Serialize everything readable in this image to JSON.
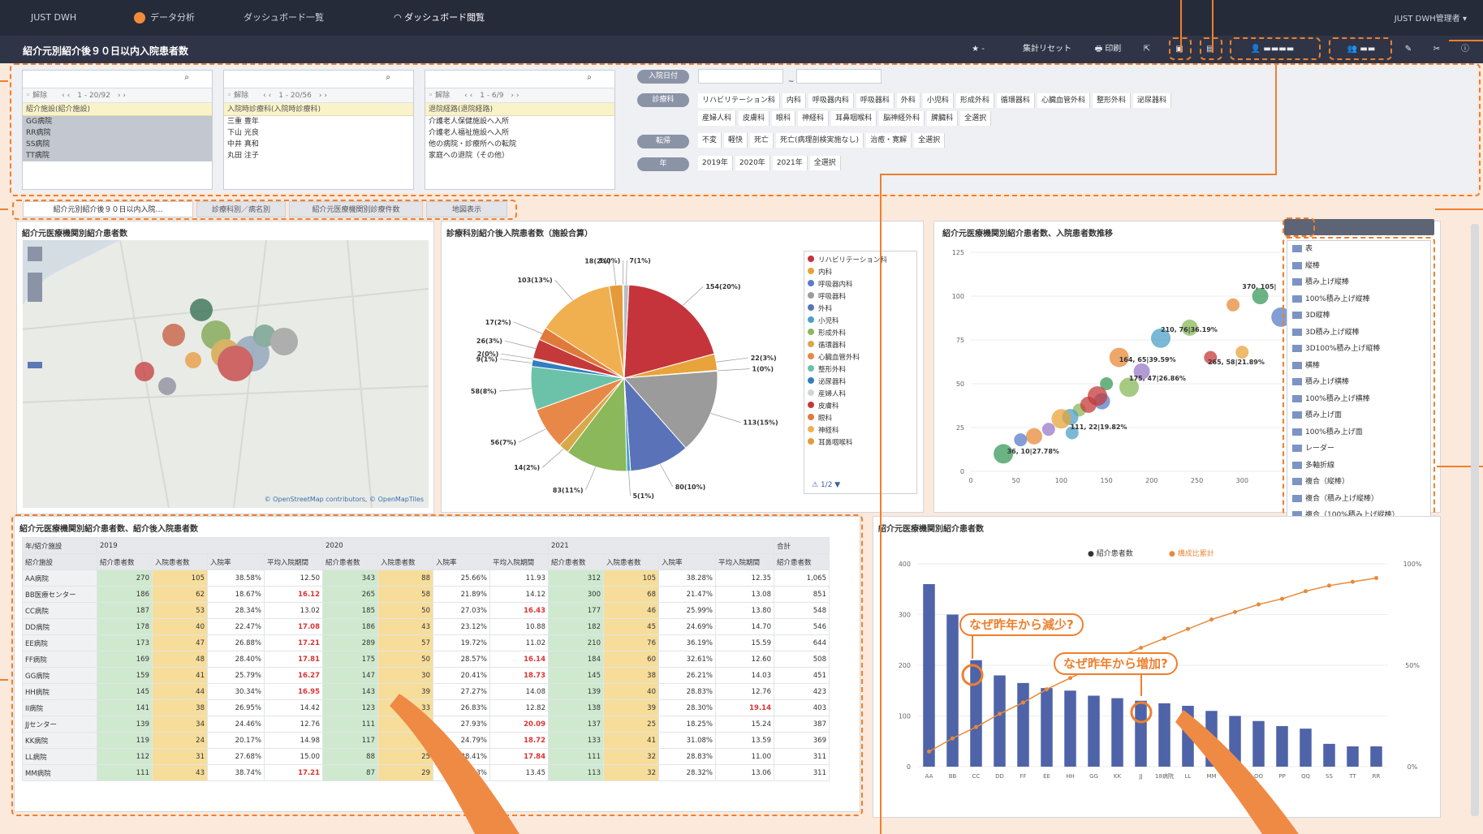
{
  "breadcrumbs": [
    "JUST DWH",
    "データ分析",
    "ダッシュボード一覧",
    "ダッシュボード閲覧"
  ],
  "user": "JUST DWH管理者 ▾",
  "title": "紹介元別紹介後９０日以内入院患者数",
  "toolbar": {
    "star": "★ -",
    "reset": "集計リセット",
    "print": "印刷"
  },
  "filters": {
    "lists": [
      {
        "paging": "1 - 20/92",
        "header": "紹介施設(紹介施設)",
        "rows": [
          "GG病院",
          "RR病院",
          "SS病院",
          "TT病院"
        ]
      },
      {
        "paging": "1 - 20/56",
        "header": "入院時診療科(入院時診療科)",
        "rows": [
          "三重 豊年",
          "下山 光良",
          "中井 真和",
          "丸田 注子"
        ]
      },
      {
        "paging": "1 - 6/9",
        "header": "退院経路(退院経路)",
        "rows": [
          "介護老人保健施設へ入所",
          "介護老人福祉施設へ入所",
          "他の病院・診療所への転院",
          "家庭への退院（その他）"
        ]
      }
    ],
    "groups": [
      {
        "label": "入院日付",
        "values": []
      },
      {
        "label": "診療科",
        "values": [
          "リハビリテーション科",
          "内科",
          "呼吸器内科",
          "呼吸器科",
          "外科",
          "小児科",
          "形成外科",
          "循環器科",
          "心臓血管外科",
          "整形外科",
          "泌尿器科",
          "産婦人科",
          "皮膚科",
          "眼科",
          "神経科",
          "耳鼻咽喉科",
          "脳神経外科",
          "脾臓科",
          "全選択"
        ]
      },
      {
        "label": "転帰",
        "values": [
          "不変",
          "軽快",
          "死亡",
          "死亡(病理剖検実施なし)",
          "治癒・寛解",
          "全選択"
        ]
      },
      {
        "label": "年",
        "values": [
          "2019年",
          "2020年",
          "2021年",
          "全選択"
        ]
      }
    ]
  },
  "tabs": [
    "紹介元別紹介後９０日以内入院…",
    "診療科別／病名別",
    "紹介元医療機関別診療件数",
    "地図表示"
  ],
  "panels": {
    "map": {
      "title": "紹介元医療機関別紹介患者数",
      "attribution": "© OpenStreetMap contributors, © OpenMapTiles"
    },
    "pie": {
      "title": "診療科別紹介後入院患者数（施設合算）",
      "legend_page": "1/2"
    },
    "scatter": {
      "title": "紹介元医療機関別紹介患者数、入院患者数推移"
    },
    "table": {
      "title": "紹介元医療機関別紹介患者数、紹介後入院患者数"
    },
    "combo": {
      "title": "紹介元医療機関別紹介患者数"
    }
  },
  "chart_types": [
    "表",
    "縦棒",
    "積み上げ縦棒",
    "100%積み上げ縦棒",
    "3D縦棒",
    "3D積み上げ縦棒",
    "3D100%積み上げ縦棒",
    "横棒",
    "積み上げ横棒",
    "100%積み上げ横棒",
    "積み上げ面",
    "100%積み上げ面",
    "レーダー",
    "多軸折線",
    "複合（縦棒）",
    "複合（積み上げ縦棒）",
    "複合（100%積み上げ縦棒）",
    "複合（マーカー）",
    "複合（縦棒・積み上げ縦棒）",
    "複合（横棒・積み上げ横棒）",
    "散布図",
    "バブル",
    "サマリー表示"
  ],
  "callouts": [
    "なぜ昨年から減少?",
    "なぜ昨年から増加?"
  ],
  "table": {
    "years": [
      "2019",
      "2020",
      "2021",
      "合計"
    ],
    "row_header": "紹介施設",
    "col_headers": [
      "紹介患者数",
      "入院患者数",
      "入院率",
      "平均入院期間"
    ],
    "rows": [
      {
        "name": "AA病院",
        "v": [
          "270",
          "105",
          "38.58%",
          "12.50",
          "343",
          "88",
          "25.66%",
          "11.93",
          "312",
          "105",
          "38.28%",
          "12.35",
          "1,065"
        ]
      },
      {
        "name": "BB医療センター",
        "v": [
          "186",
          "62",
          "18.67%",
          "16.12",
          "265",
          "58",
          "21.89%",
          "14.12",
          "300",
          "68",
          "21.47%",
          "13.08",
          "851"
        ]
      },
      {
        "name": "CC病院",
        "v": [
          "187",
          "53",
          "28.34%",
          "13.02",
          "185",
          "50",
          "27.03%",
          "16.43",
          "177",
          "46",
          "25.99%",
          "13.80",
          "548"
        ]
      },
      {
        "name": "DD病院",
        "v": [
          "178",
          "40",
          "22.47%",
          "17.08",
          "186",
          "43",
          "23.12%",
          "10.88",
          "182",
          "45",
          "24.69%",
          "14.70",
          "546"
        ]
      },
      {
        "name": "EE病院",
        "v": [
          "173",
          "47",
          "26.88%",
          "17.21",
          "289",
          "57",
          "19.72%",
          "11.02",
          "210",
          "76",
          "36.19%",
          "15.59",
          "644"
        ]
      },
      {
        "name": "FF病院",
        "v": [
          "169",
          "48",
          "28.40%",
          "17.81",
          "175",
          "50",
          "28.57%",
          "16.14",
          "184",
          "60",
          "32.61%",
          "12.60",
          "508"
        ]
      },
      {
        "name": "GG病院",
        "v": [
          "159",
          "41",
          "25.79%",
          "16.27",
          "147",
          "30",
          "20.41%",
          "18.73",
          "145",
          "38",
          "26.21%",
          "14.03",
          "451"
        ]
      },
      {
        "name": "HH病院",
        "v": [
          "145",
          "44",
          "30.34%",
          "16.95",
          "143",
          "39",
          "27.27%",
          "14.08",
          "139",
          "40",
          "28.83%",
          "12.76",
          "423"
        ]
      },
      {
        "name": "II病院",
        "v": [
          "141",
          "38",
          "26.95%",
          "14.42",
          "123",
          "33",
          "26.83%",
          "12.82",
          "138",
          "39",
          "28.30%",
          "19.14",
          "403"
        ]
      },
      {
        "name": "JJセンター",
        "v": [
          "139",
          "34",
          "24.46%",
          "12.76",
          "111",
          "31",
          "27.93%",
          "20.09",
          "137",
          "25",
          "18.25%",
          "15.24",
          "387"
        ]
      },
      {
        "name": "KK病院",
        "v": [
          "119",
          "24",
          "20.17%",
          "14.98",
          "117",
          "29",
          "24.79%",
          "18.72",
          "133",
          "41",
          "31.08%",
          "13.59",
          "369"
        ]
      },
      {
        "name": "LL病院",
        "v": [
          "112",
          "31",
          "27.68%",
          "15.00",
          "88",
          "25",
          "28.41%",
          "17.84",
          "111",
          "32",
          "28.83%",
          "11.00",
          "311"
        ]
      },
      {
        "name": "MM病院",
        "v": [
          "111",
          "43",
          "38.74%",
          "17.21",
          "87",
          "29",
          "33.33%",
          "13.45",
          "113",
          "32",
          "28.32%",
          "13.06",
          "311"
        ]
      }
    ]
  },
  "chart_data": [
    {
      "type": "pie",
      "title": "診療科別紹介後入院患者数（施設合算）",
      "labels": [
        "154(20%)",
        "22(3%)",
        "1(0%)",
        "113(15%)",
        "80(10%)",
        "5(1%)",
        "83(11%)",
        "14(2%)",
        "56(7%)",
        "58(8%)",
        "9(1%)",
        "2(0%)",
        "26(3%)",
        "17(2%)",
        "103(13%)",
        "18(2%)",
        "1(0%)",
        "7(1%)"
      ],
      "values": [
        154,
        22,
        1,
        113,
        80,
        5,
        83,
        14,
        56,
        58,
        9,
        2,
        26,
        17,
        103,
        18,
        1,
        7
      ],
      "colors": [
        "#c5343a",
        "#e8a33a",
        "#5a7ec8",
        "#9b9b9b",
        "#5a72b8",
        "#4da0c7",
        "#8ab85a",
        "#d9a848",
        "#e88848",
        "#6bc2a8",
        "#2f7fbf",
        "#d2d4d6",
        "#c43a3a",
        "#e07a3a",
        "#f0b050",
        "#e59a3a",
        "#5d6fb6",
        "#b8bcc4"
      ],
      "legend": [
        "リハビリテーション科",
        "内科",
        "呼吸器内科",
        "呼吸器科",
        "外科",
        "小児科",
        "形成外科",
        "循環器科",
        "心臓血管外科",
        "整形外科",
        "泌尿器科",
        "産婦人科",
        "皮膚科",
        "眼科",
        "神経科",
        "耳鼻咽喉科"
      ]
    },
    {
      "type": "scatter",
      "title": "紹介元医療機関別紹介患者数、入院患者数推移",
      "xlim": [
        0,
        350
      ],
      "ylim": [
        0,
        125
      ],
      "xticks": [
        "0",
        "50",
        "100",
        "150",
        "200",
        "250",
        "300"
      ],
      "yticks": [
        "0",
        "25",
        "50",
        "75",
        "100",
        "125"
      ],
      "points": [
        [
          290,
          95
        ],
        [
          320,
          100
        ],
        [
          343,
          88
        ],
        [
          265,
          65
        ],
        [
          242,
          82
        ],
        [
          210,
          76
        ],
        [
          300,
          68
        ],
        [
          189,
          57
        ],
        [
          164,
          65
        ],
        [
          150,
          50
        ],
        [
          145,
          40
        ],
        [
          140,
          43
        ],
        [
          120,
          35
        ],
        [
          110,
          31
        ],
        [
          100,
          30
        ],
        [
          86,
          24
        ],
        [
          70,
          20
        ],
        [
          36,
          10
        ],
        [
          55,
          18
        ],
        [
          130,
          38
        ],
        [
          175,
          48
        ],
        [
          112,
          22
        ]
      ],
      "labels": [
        "370, 105|",
        "343, 88|",
        "210, 76|36.19%",
        "164, 65|39.59%",
        "265, 58|21.89%",
        "175, 47|26.86%",
        "36, 10|27.78%",
        "111, 22|19.82%"
      ]
    },
    {
      "type": "bar",
      "title": "紹介元医療機関別紹介患者数",
      "categories": [
        "AA",
        "BB",
        "CC",
        "DD",
        "FF",
        "EE",
        "HH",
        "GG",
        "KK",
        "JJ",
        "18病院",
        "LL",
        "MM",
        "NN",
        "OO",
        "PP",
        "QQ",
        "SS",
        "TT",
        "RR"
      ],
      "series": [
        {
          "name": "紹介患者数",
          "values": [
            360,
            300,
            210,
            180,
            165,
            155,
            150,
            140,
            135,
            130,
            125,
            120,
            110,
            100,
            90,
            80,
            75,
            45,
            40,
            40
          ]
        },
        {
          "name": "構成比累計",
          "values": [
            8,
            15,
            21,
            28,
            34,
            41,
            47,
            53,
            58,
            63,
            68,
            73,
            78,
            82,
            86,
            89,
            93,
            96,
            98,
            100
          ]
        }
      ],
      "yticks": [
        "0",
        "100",
        "200",
        "300",
        "400"
      ],
      "y2ticks": [
        "0%",
        "50%",
        "100%"
      ]
    }
  ]
}
